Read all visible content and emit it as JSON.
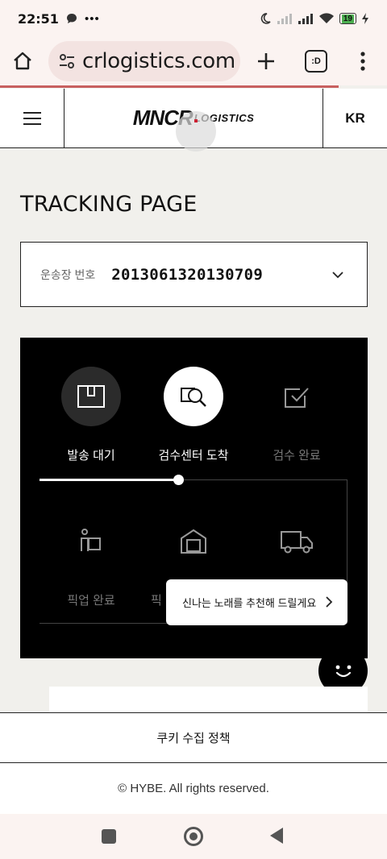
{
  "status_bar": {
    "time": "22:51",
    "battery": "19",
    "icons": [
      "messenger-icon",
      "more-icon",
      "moon-icon",
      "signal-icon",
      "signal-icon",
      "wifi-icon",
      "battery-icon",
      "charging-icon"
    ]
  },
  "browser": {
    "url": "crlogistics.com",
    "tab_count": ":D"
  },
  "header": {
    "logo_main": "MNCR",
    "logo_sub": "LOGISTICS",
    "lang": "KR"
  },
  "page": {
    "title": "TRACKING PAGE"
  },
  "tracking": {
    "label": "운송장 번호",
    "number": "2013061320130709"
  },
  "steps": [
    {
      "label": "발송 대기",
      "icon": "box-icon",
      "state": "done"
    },
    {
      "label": "검수센터 도착",
      "icon": "inspect-icon",
      "state": "current"
    },
    {
      "label": "검수 완료",
      "icon": "check-box-icon",
      "state": "pending"
    },
    {
      "label": "픽업 완료",
      "icon": "pickup-icon",
      "state": "pending"
    },
    {
      "label": "픽",
      "icon": "warehouse-icon",
      "state": "pending"
    },
    {
      "label": "",
      "icon": "truck-icon",
      "state": "pending"
    }
  ],
  "progress": {
    "fraction": 0.45
  },
  "chat": {
    "tooltip": "신나는 노래를 추천해 드릴게요"
  },
  "cookie": "쿠키 수집 정책",
  "footer": "© HYBE. All rights reserved.",
  "colors": {
    "panel_bg": "#000000",
    "page_bg": "#f1f0ec",
    "progress_bar": "#c86060"
  }
}
